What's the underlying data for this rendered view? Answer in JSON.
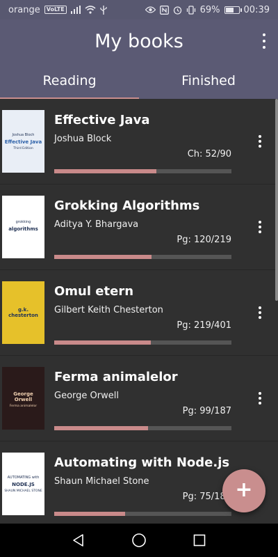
{
  "status_bar": {
    "carrier": "orange",
    "volte": "VoLTE",
    "battery_percent": "69%",
    "battery_level": 0.69,
    "time": "00:39"
  },
  "app_bar": {
    "title": "My books",
    "menu_icon": "more-vert-icon"
  },
  "tabs": [
    {
      "label": "Reading",
      "active": true
    },
    {
      "label": "Finished",
      "active": false
    }
  ],
  "books": [
    {
      "title": "Effective Java",
      "author": "Joshua Block",
      "progress_text": "Ch: 52/90",
      "progress": 0.578,
      "cover": {
        "bg": "#e9eef6",
        "top_text": "Joshua Bloch",
        "main_text": "Effective Java",
        "sub_text": "Third Edition"
      }
    },
    {
      "title": "Grokking Algorithms",
      "author": "Aditya Y. Bhargava",
      "progress_text": "Pg: 120/219",
      "progress": 0.548,
      "cover": {
        "bg": "#ffffff",
        "top_text": "grokking",
        "main_text": "algorithms"
      }
    },
    {
      "title": "Omul etern",
      "author": "Gilbert Keith Chesterton",
      "progress_text": "Pg: 219/401",
      "progress": 0.546,
      "cover": {
        "bg": "#e6c12a",
        "main_text": "g.k. chesterton"
      }
    },
    {
      "title": "Ferma animalelor",
      "author": "George Orwell",
      "progress_text": "Pg: 99/187",
      "progress": 0.529,
      "cover": {
        "bg": "#2a1a1a",
        "main_text": "George Orwell",
        "sub_text": "Ferma animalelor"
      }
    },
    {
      "title": "Automating with Node.js",
      "author": "Shaun Michael Stone",
      "progress_text": "Pg: 75/187",
      "progress": 0.401,
      "cover": {
        "bg": "#ffffff",
        "top_text": "AUTOMATING with",
        "main_text": "NODE.JS",
        "sub_text": "SHAUN MICHAEL STONE"
      }
    }
  ],
  "fab": {
    "label": "+",
    "icon": "add-icon"
  },
  "colors": {
    "primary": "#5b5a74",
    "accent": "#c98e8e",
    "background": "#303030"
  }
}
